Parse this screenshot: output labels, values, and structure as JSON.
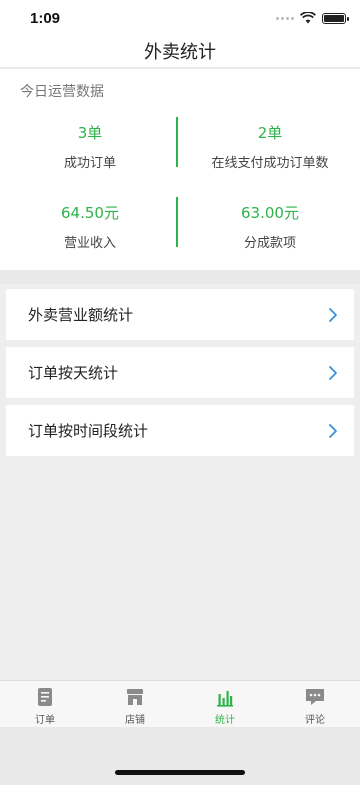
{
  "status_bar": {
    "time": "1:09"
  },
  "nav": {
    "title": "外卖统计"
  },
  "ops": {
    "title": "今日运营数据",
    "metrics": [
      {
        "value": "3单",
        "label": "成功订单"
      },
      {
        "value": "2单",
        "label": "在线支付成功订单数"
      },
      {
        "value": "64.50元",
        "label": "营业收入"
      },
      {
        "value": "63.00元",
        "label": "分成款项"
      }
    ]
  },
  "menu": [
    {
      "label": "外卖营业额统计"
    },
    {
      "label": "订单按天统计"
    },
    {
      "label": "订单按时间段统计"
    }
  ],
  "tabbar": {
    "active": "统计",
    "active_color": "#2db34a",
    "tabs": [
      {
        "label": "订单",
        "icon": "order-document-icon"
      },
      {
        "label": "店铺",
        "icon": "shop-icon"
      },
      {
        "label": "统计",
        "icon": "bar-chart-icon"
      },
      {
        "label": "评论",
        "icon": "comment-bubble-icon"
      }
    ]
  }
}
